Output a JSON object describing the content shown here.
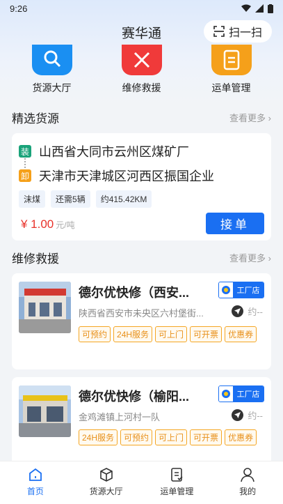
{
  "status_bar": {
    "time": "9:26"
  },
  "header": {
    "title": "赛华通",
    "scan_label": "扫一扫"
  },
  "quick_menu": [
    {
      "label": "货源大厅",
      "icon": "search-icon",
      "color": "#1a8ff2"
    },
    {
      "label": "维修救援",
      "icon": "tools-icon",
      "color": "#f03a3a"
    },
    {
      "label": "运单管理",
      "icon": "clipboard-icon",
      "color": "#f5a01a"
    }
  ],
  "featured_goods": {
    "title": "精选货源",
    "more": "查看更多 ›",
    "card": {
      "load_badge": "装",
      "unload_badge": "卸",
      "from": "山西省大同市云州区煤矿厂",
      "to": "天津市天津城区河西区振国企业",
      "tags": [
        "沫煤",
        "还需5辆",
        "约415.42KM"
      ],
      "price": "¥ 1.00",
      "price_unit": "元/吨",
      "accept_label": "接单"
    }
  },
  "repair": {
    "title": "维修救援",
    "more": "查看更多 ›",
    "shops": [
      {
        "name": "德尔优快修（西安...",
        "badge": "工厂店",
        "address": "陕西省西安市未央区六村堡街...",
        "distance": "约--",
        "tags": [
          "可预约",
          "24H服务",
          "可上门",
          "可开票",
          "优惠券"
        ]
      },
      {
        "name": "德尔优快修（榆阳...",
        "badge": "工厂店",
        "address": "金鸡滩镇上河村一队",
        "distance": "约--",
        "tags": [
          "24H服务",
          "可预约",
          "可上门",
          "可开票",
          "优惠券"
        ]
      }
    ]
  },
  "tab_bar": [
    {
      "label": "首页",
      "icon": "home-icon",
      "active": true
    },
    {
      "label": "货源大厅",
      "icon": "cube-icon",
      "active": false
    },
    {
      "label": "运单管理",
      "icon": "document-icon",
      "active": false
    },
    {
      "label": "我的",
      "icon": "user-icon",
      "active": false
    }
  ],
  "colors": {
    "accent": "#1a6ff2",
    "price": "#e8322a",
    "tag_orange": "#f5a623",
    "load_badge": "#1aa37a",
    "unload_badge": "#f5a01a"
  }
}
